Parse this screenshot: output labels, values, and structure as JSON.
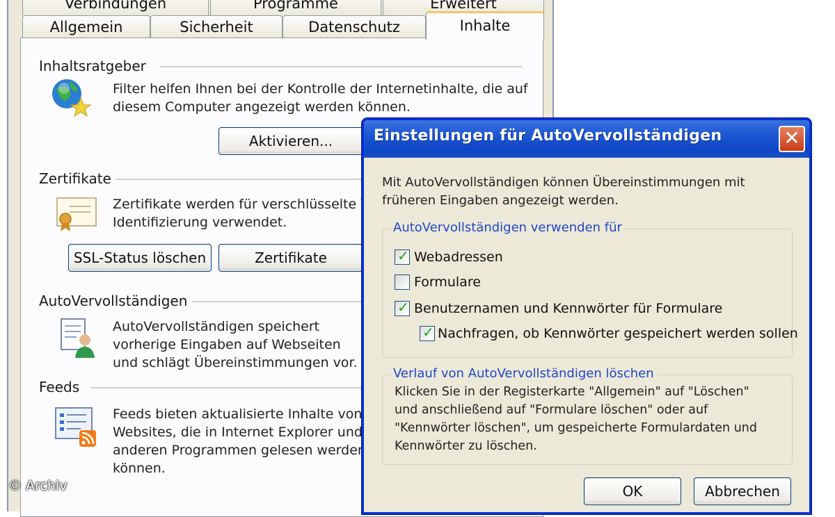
{
  "options_window": {
    "tabs_back": [
      "Verbindungen",
      "Programme",
      "Erweitert"
    ],
    "tabs_front": [
      "Allgemein",
      "Sicherheit",
      "Datenschutz",
      "Inhalte"
    ],
    "content_advisor": {
      "title": "Inhaltsratgeber",
      "text_line1": "Filter helfen Ihnen bei der Kontrolle der Internetinhalte, die auf",
      "text_line2": "diesem Computer angezeigt werden können.",
      "activate_button": "Aktivieren..."
    },
    "certificates": {
      "title": "Zertifikate",
      "text_line1": "Zertifikate werden für verschlüsselte Ve",
      "text_line2": "Identifizierung verwendet.",
      "ssl_button": "SSL-Status löschen",
      "cert_button": "Zertifikate"
    },
    "autocomplete": {
      "title": "AutoVervollständigen",
      "text_line1": "AutoVervollständigen speichert",
      "text_line2": "vorherige Eingaben auf Webseiten",
      "text_line3": "und schlägt Übereinstimmungen vor."
    },
    "feeds": {
      "title": "Feeds",
      "text_line1": "Feeds bieten aktualisierte Inhalte von",
      "text_line2": "Websites, die in Internet Explorer und",
      "text_line3": "anderen Programmen gelesen werden",
      "text_line4": "können."
    }
  },
  "autocomplete_dialog": {
    "title": "Einstellungen für AutoVervollständigen",
    "close_glyph": "✕",
    "intro_line1": "Mit AutoVervollständigen können Übereinstimmungen mit",
    "intro_line2": "früheren Eingaben angezeigt werden.",
    "use_group": {
      "legend": "AutoVervollständigen verwenden für",
      "options": [
        {
          "label": "Webadressen",
          "checked": true
        },
        {
          "label": "Formulare",
          "checked": false
        },
        {
          "label": "Benutzernamen und Kennwörter für Formulare",
          "checked": true
        },
        {
          "label": "Nachfragen, ob Kennwörter gespeichert werden sollen",
          "checked": true
        }
      ]
    },
    "history_group": {
      "legend": "Verlauf von AutoVervollständigen löschen",
      "line1": "Klicken Sie in der Registerkarte \"Allgemein\" auf \"Löschen\"",
      "line2": "und anschließend auf \"Formulare löschen\" oder auf",
      "line3": "\"Kennwörter löschen\", um gespeicherte Formulardaten und",
      "line4": "Kennwörter zu löschen."
    },
    "ok_button": "OK",
    "cancel_button": "Abbrechen"
  },
  "watermark": "© Archiv",
  "colors": {
    "window_bg": "#ece9d8",
    "titlebar": "#0d45c6",
    "legend_text": "#1f46c8",
    "check": "#21a121"
  },
  "icons": [
    "globe-star-icon",
    "certificate-icon",
    "autocomplete-user-icon",
    "feed-list-icon",
    "close-icon",
    "checkmark-icon"
  ]
}
